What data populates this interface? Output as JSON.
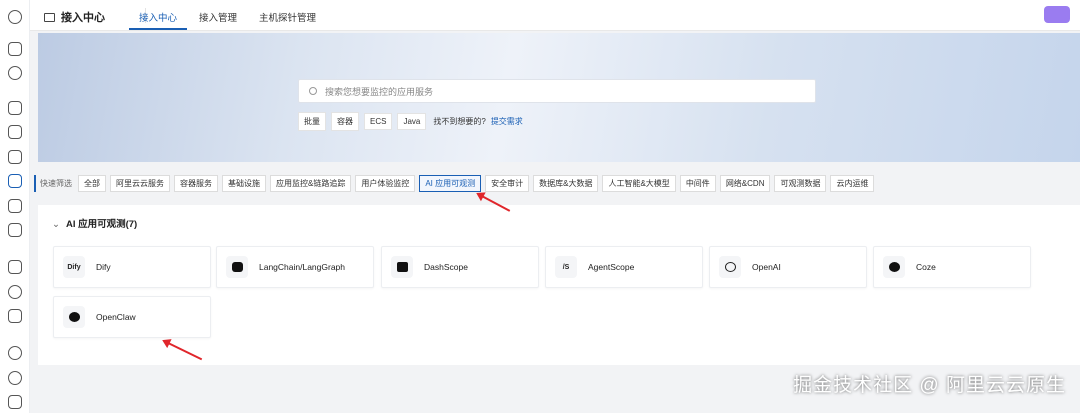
{
  "header": {
    "title": "接入中心",
    "tabs": [
      {
        "label": "接入中心",
        "active": true
      },
      {
        "label": "接入管理"
      },
      {
        "label": "主机探针管理"
      }
    ]
  },
  "banner": {
    "search_placeholder": "搜索您想要监控的应用服务",
    "quick_tags": [
      "批量",
      "容器",
      "ECS",
      "Java"
    ],
    "hint": "找不到想要的?",
    "hint_link": "提交需求"
  },
  "filters": {
    "label": "快速筛选",
    "items": [
      "全部",
      "阿里云云服务",
      "容器服务",
      "基础设施",
      "应用监控&链路追踪",
      "用户体验监控",
      "AI 应用可观测",
      "安全审计",
      "数据库&大数据",
      "人工智能&大模型",
      "中间件",
      "网络&CDN",
      "可观测数据",
      "云内运维"
    ],
    "active": "AI 应用可观测"
  },
  "section": {
    "title": "AI 应用可观测(7)",
    "cards": [
      {
        "name": "Dify",
        "logo_text": "Dify"
      },
      {
        "name": "LangChain/LangGraph"
      },
      {
        "name": "DashScope"
      },
      {
        "name": "AgentScope",
        "logo_text": "/S"
      },
      {
        "name": "OpenAI"
      },
      {
        "name": "Coze"
      },
      {
        "name": "OpenClaw"
      }
    ]
  },
  "watermark": "掘金技术社区 @ 阿里云云原生",
  "colors": {
    "accent": "#1a5fb4",
    "arrow": "#e0262b",
    "ai_button": "#9a7cf0"
  }
}
